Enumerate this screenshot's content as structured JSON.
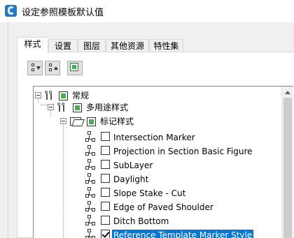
{
  "window": {
    "title": "设定参照模板默认值"
  },
  "tabs": [
    {
      "label": "样式",
      "active": true
    },
    {
      "label": "设置",
      "active": false
    },
    {
      "label": "图层",
      "active": false
    },
    {
      "label": "其他资源",
      "active": false
    },
    {
      "label": "特性集",
      "active": false
    }
  ],
  "toolbar": {
    "expand_icon": "expand-all-icon",
    "collapse_icon": "collapse-all-icon",
    "select_icon": "select-all-icon"
  },
  "tree": {
    "root": {
      "label": "常规",
      "state": "partial"
    },
    "level1": {
      "label": "多用途样式",
      "state": "partial"
    },
    "level2": {
      "label": "标记样式",
      "state": "partial"
    },
    "items": [
      {
        "label": "Intersection Marker",
        "checked": false,
        "selected": false
      },
      {
        "label": "Projection in Section Basic Figure",
        "checked": false,
        "selected": false
      },
      {
        "label": "SubLayer",
        "checked": false,
        "selected": false
      },
      {
        "label": "Daylight",
        "checked": false,
        "selected": false
      },
      {
        "label": "Slope Stake - Cut",
        "checked": false,
        "selected": false
      },
      {
        "label": "Edge of Paved Shoulder",
        "checked": false,
        "selected": false
      },
      {
        "label": "Ditch Bottom",
        "checked": false,
        "selected": false
      },
      {
        "label": "Reference Template Marker Style",
        "checked": true,
        "selected": true
      }
    ]
  },
  "colors": {
    "accent": "#0078d7",
    "partial_green": "#3cb44b",
    "title_icon": "#1f78c8"
  }
}
